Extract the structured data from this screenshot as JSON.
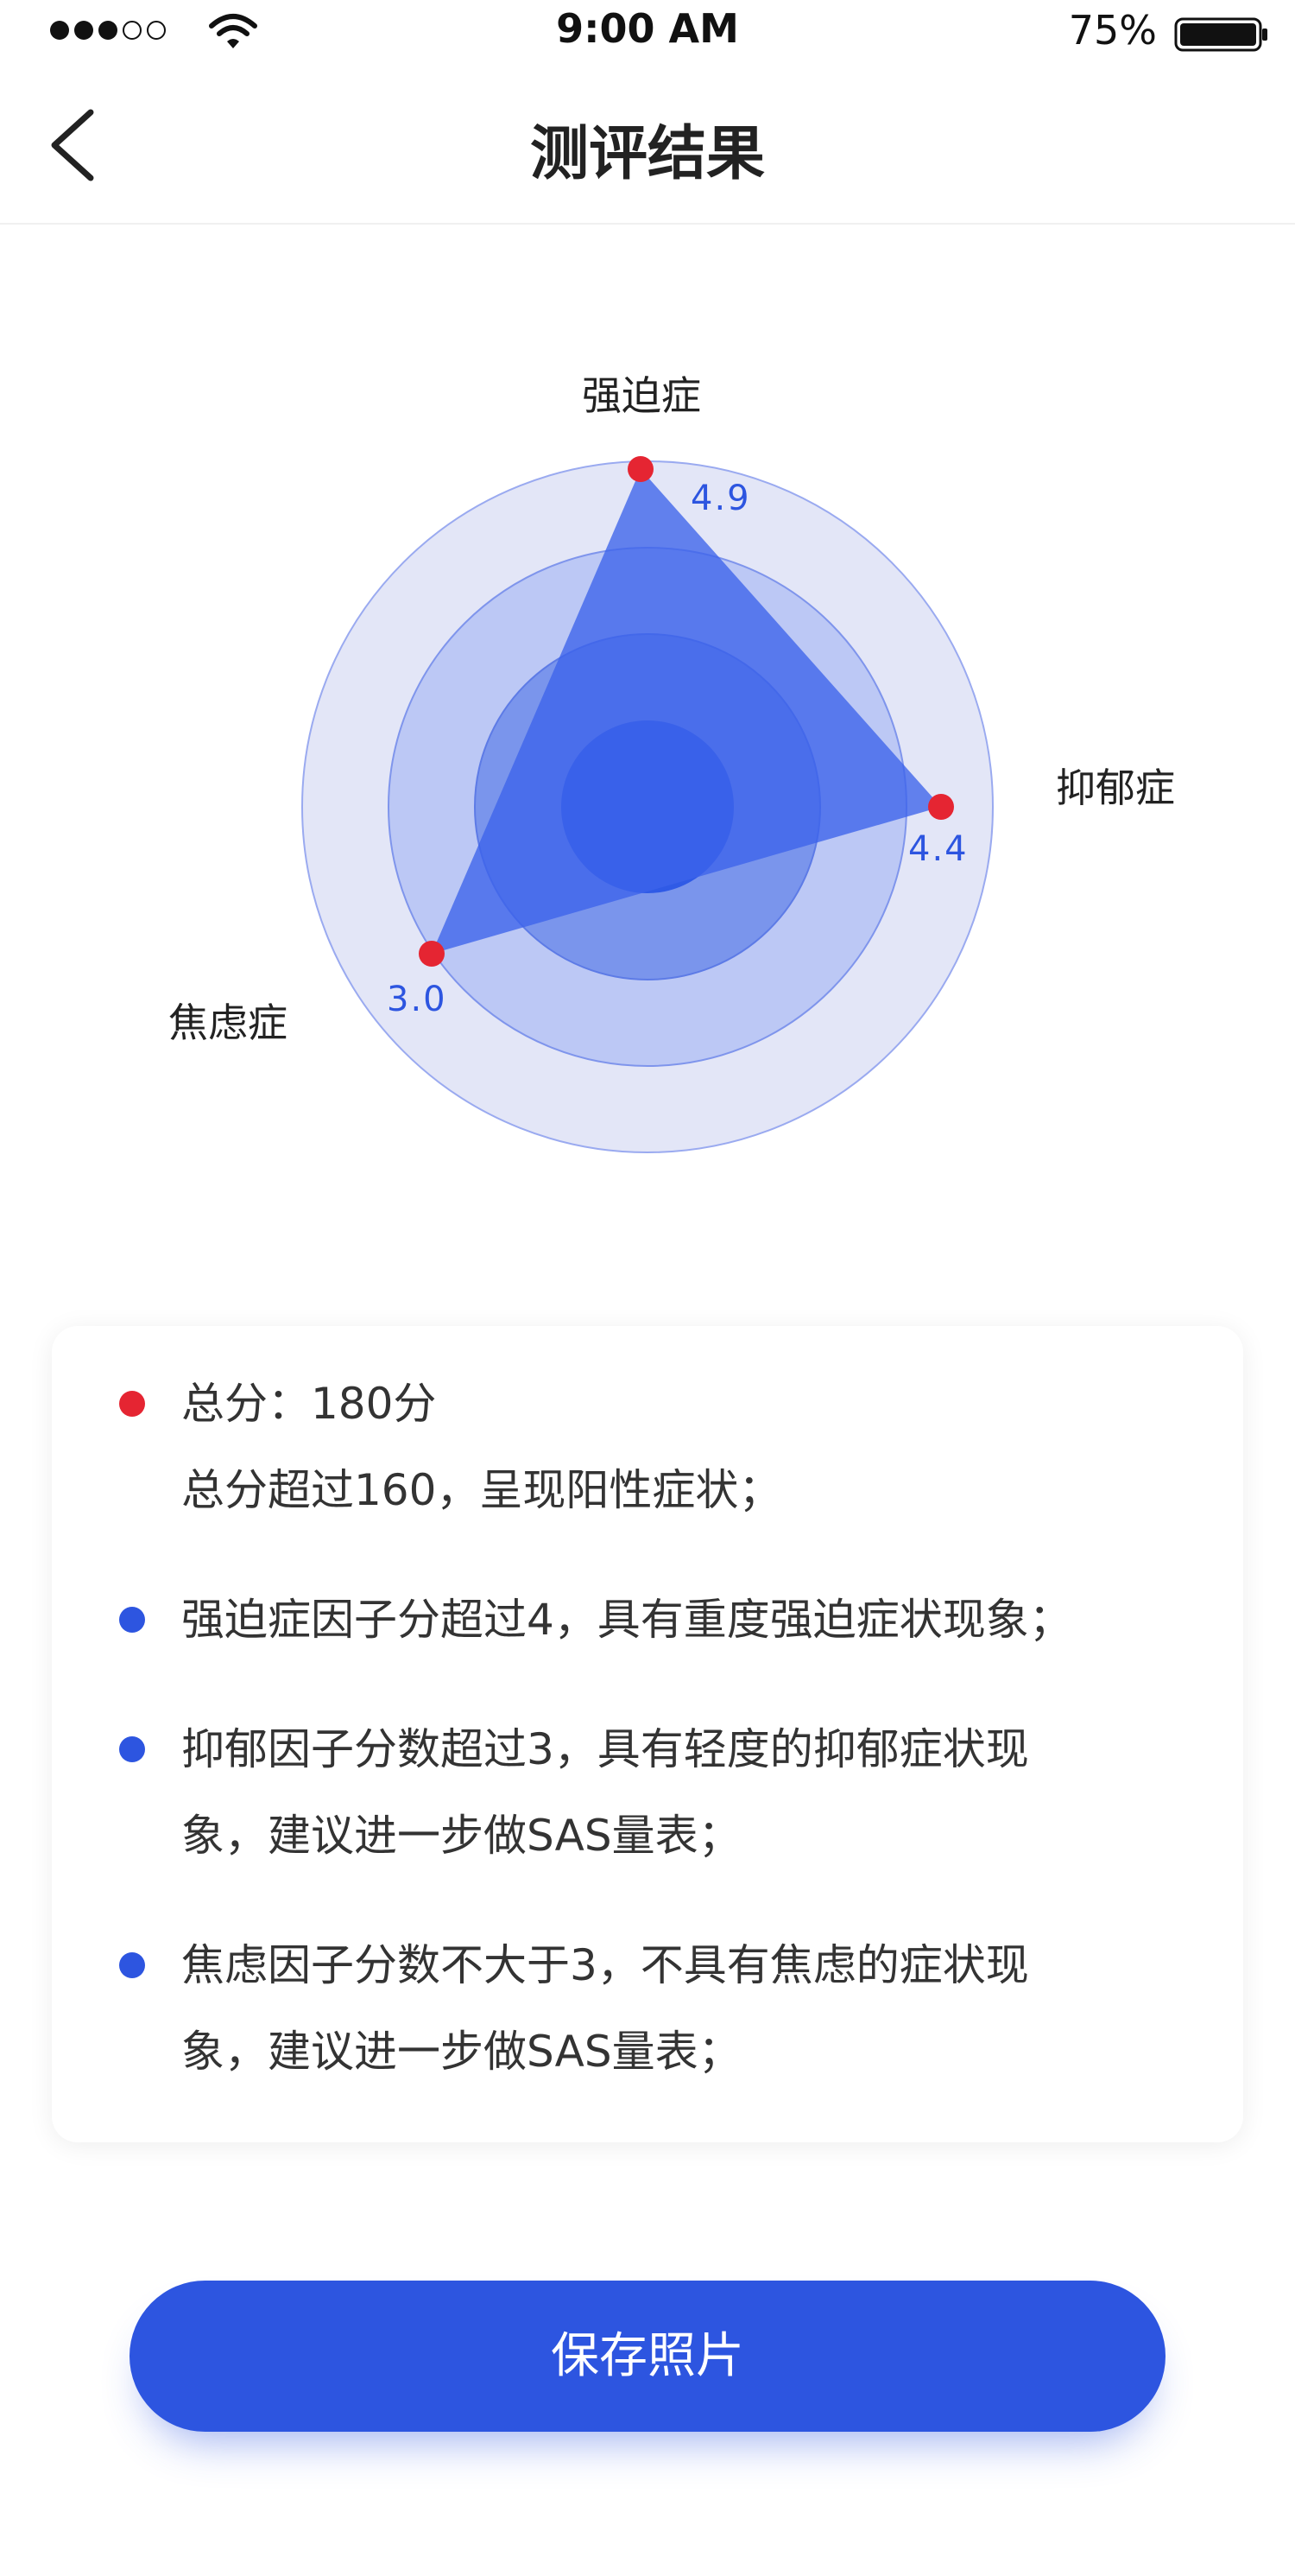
{
  "status_bar": {
    "time": "9:00 AM",
    "battery": "75%",
    "signal_icon": "signal-dots-icon",
    "wifi_icon": "wifi-icon",
    "battery_icon": "battery-icon"
  },
  "nav": {
    "back_icon": "chevron-left-icon",
    "title": "测评结果"
  },
  "colors": {
    "accent": "#2d55e0",
    "point": "#e52532",
    "ring_outer": "#e3e6f7",
    "ring_mid": "#bcc8f5",
    "ring_inner": "#7a95ec",
    "ring_core": "#2f5ae6"
  },
  "radar": {
    "axes": [
      {
        "name": "强迫症",
        "value": "4.9"
      },
      {
        "name": "抑郁症",
        "value": "4.4"
      },
      {
        "name": "焦虑症",
        "value": "3.0"
      }
    ]
  },
  "summary": {
    "items": [
      {
        "color": "#e52532",
        "lines": [
          "总分：180分",
          "总分超过160，呈现阳性症状；"
        ]
      },
      {
        "color": "#2d55e0",
        "lines": [
          "强迫症因子分超过4，具有重度强迫症状现象；"
        ]
      },
      {
        "color": "#2d55e0",
        "lines": [
          "抑郁因子分数超过3，具有轻度的抑郁症状现",
          "象，建议进一步做SAS量表；"
        ]
      },
      {
        "color": "#2d55e0",
        "lines": [
          "焦虑因子分数不大于3，不具有焦虑的症状现",
          "象，建议进一步做SAS量表；"
        ]
      }
    ]
  },
  "save_button": {
    "label": "保存照片"
  }
}
